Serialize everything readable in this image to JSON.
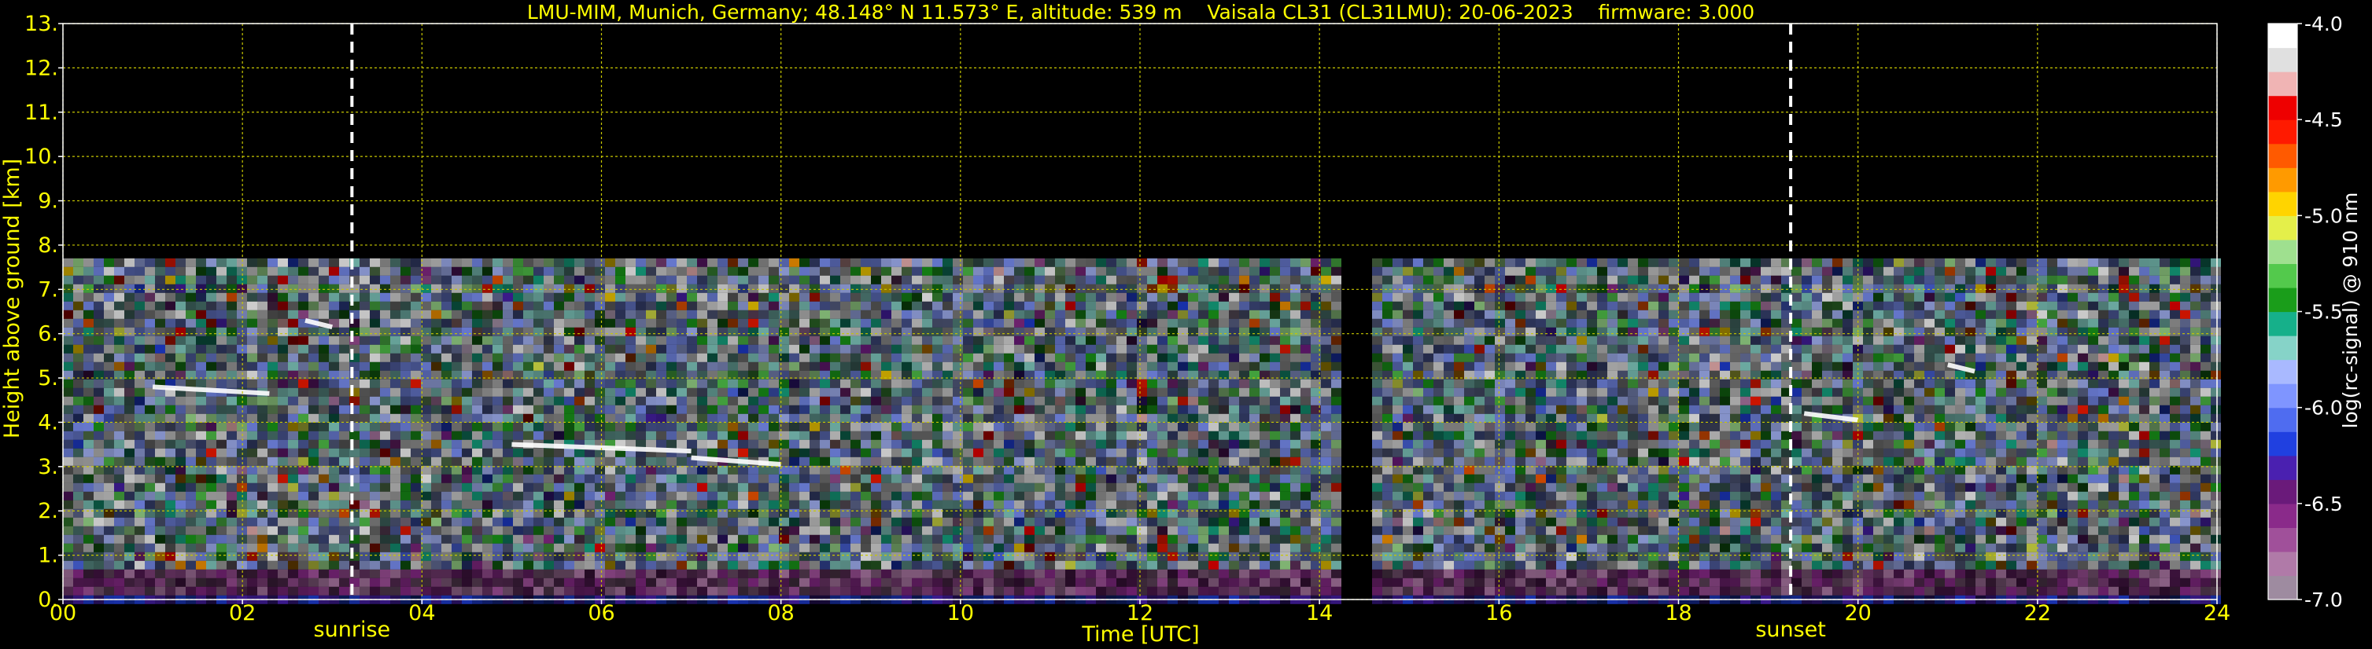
{
  "chart_data": {
    "type": "heatmap",
    "title": "LMU-MIM, Munich, Germany; 48.148° N 11.573° E, altitude: 539 m    Vaisala CL31 (CL31LMU): 20-06-2023    firmware: 3.000",
    "xlabel": "Time [UTC]",
    "ylabel": "Height above ground [km]",
    "colorbar_label": "log(rc-signal) @ 910 nm",
    "x_ticks": [
      "00",
      "02",
      "04",
      "06",
      "08",
      "10",
      "12",
      "14",
      "16",
      "18",
      "20",
      "22",
      "24"
    ],
    "y_ticks": [
      "0.",
      "1.",
      "2.",
      "3.",
      "4.",
      "5.",
      "6.",
      "7.",
      "8.",
      "9.",
      "10.",
      "11.",
      "12.",
      "13."
    ],
    "colorbar_ticks": [
      "-4.0",
      "-4.5",
      "-5.0",
      "-5.5",
      "-6.0",
      "-6.5",
      "-7.0"
    ],
    "xlim": [
      0,
      24
    ],
    "ylim": [
      0,
      13
    ],
    "clim": [
      -7.0,
      -4.0
    ],
    "grid": true,
    "data_max_height_km": 7.7,
    "data_gap_hours": [
      14.35,
      14.5
    ],
    "events": [
      {
        "label": "sunrise",
        "time_h": 3.22
      },
      {
        "label": "sunset",
        "time_h": 19.25
      }
    ],
    "cloud_layers": [
      {
        "t0": 1.0,
        "t1": 2.3,
        "h": 4.8
      },
      {
        "t0": 5.0,
        "t1": 7.0,
        "h": 3.5
      },
      {
        "t0": 7.0,
        "t1": 8.0,
        "h": 3.2
      },
      {
        "t0": 2.7,
        "t1": 3.0,
        "h": 6.3
      },
      {
        "t0": 21.0,
        "t1": 21.3,
        "h": 5.3
      },
      {
        "t0": 19.4,
        "t1": 20.0,
        "h": 4.2
      }
    ],
    "colors": {
      "text": "#ffff00",
      "grid": "#c8c800",
      "event_line": "#ffffff",
      "background": "#000000",
      "colorscale": [
        "#9e8ba0",
        "#b07aa8",
        "#a0509a",
        "#8a2a8a",
        "#6a1a7a",
        "#4a20b0",
        "#2040e0",
        "#4f6cf0",
        "#7f95ff",
        "#a9b9ff",
        "#86d3c8",
        "#16b08a",
        "#1a9d1a",
        "#53c94c",
        "#9fe08f",
        "#e4ef4a",
        "#ffd400",
        "#ff9a00",
        "#ff5a00",
        "#ff1a00",
        "#ee0000",
        "#f0b4b4",
        "#e0e0e0",
        "#ffffff"
      ]
    }
  }
}
